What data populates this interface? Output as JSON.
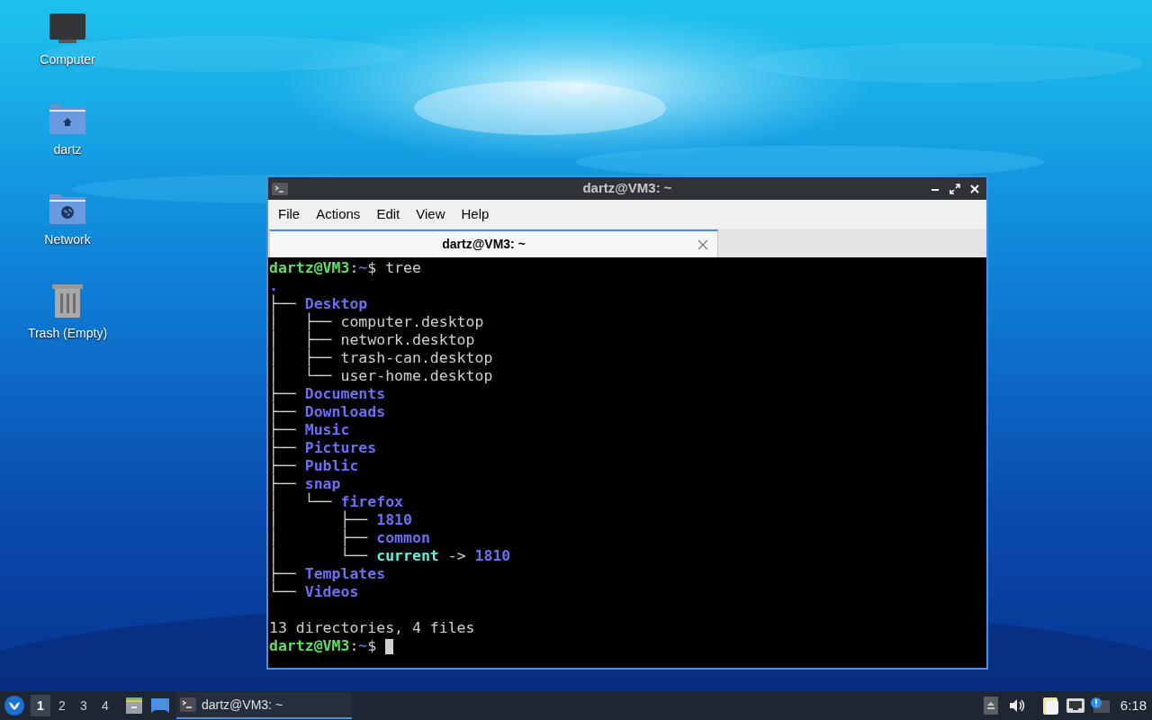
{
  "desktop_icons": [
    {
      "label": "Computer",
      "kind": "computer"
    },
    {
      "label": "dartz",
      "kind": "home"
    },
    {
      "label": "Network",
      "kind": "network"
    },
    {
      "label": "Trash (Empty)",
      "kind": "trash"
    }
  ],
  "window": {
    "title": "dartz@VM3: ~",
    "menu": [
      "File",
      "Actions",
      "Edit",
      "View",
      "Help"
    ],
    "tabs": [
      {
        "label": "dartz@VM3: ~",
        "selected": true
      }
    ],
    "terminal_lines": [
      {
        "segments": [
          {
            "kind": "user",
            "text": "dartz@VM3"
          },
          {
            "kind": "plain",
            "text": ":"
          },
          {
            "kind": "path",
            "text": "~"
          },
          {
            "kind": "plain",
            "text": "$ tree"
          }
        ]
      },
      {
        "segments": [
          {
            "kind": "path",
            "text": "."
          }
        ]
      },
      {
        "segments": [
          {
            "kind": "plain",
            "text": "├── "
          },
          {
            "kind": "dir",
            "text": "Desktop"
          }
        ]
      },
      {
        "segments": [
          {
            "kind": "plain",
            "text": "│   ├── computer.desktop"
          }
        ]
      },
      {
        "segments": [
          {
            "kind": "plain",
            "text": "│   ├── network.desktop"
          }
        ]
      },
      {
        "segments": [
          {
            "kind": "plain",
            "text": "│   ├── trash-can.desktop"
          }
        ]
      },
      {
        "segments": [
          {
            "kind": "plain",
            "text": "│   └── user-home.desktop"
          }
        ]
      },
      {
        "segments": [
          {
            "kind": "plain",
            "text": "├── "
          },
          {
            "kind": "dir",
            "text": "Documents"
          }
        ]
      },
      {
        "segments": [
          {
            "kind": "plain",
            "text": "├── "
          },
          {
            "kind": "dir",
            "text": "Downloads"
          }
        ]
      },
      {
        "segments": [
          {
            "kind": "plain",
            "text": "├── "
          },
          {
            "kind": "dir",
            "text": "Music"
          }
        ]
      },
      {
        "segments": [
          {
            "kind": "plain",
            "text": "├── "
          },
          {
            "kind": "dir",
            "text": "Pictures"
          }
        ]
      },
      {
        "segments": [
          {
            "kind": "plain",
            "text": "├── "
          },
          {
            "kind": "dir",
            "text": "Public"
          }
        ]
      },
      {
        "segments": [
          {
            "kind": "plain",
            "text": "├── "
          },
          {
            "kind": "dir",
            "text": "snap"
          }
        ]
      },
      {
        "segments": [
          {
            "kind": "plain",
            "text": "│   └── "
          },
          {
            "kind": "dir",
            "text": "firefox"
          }
        ]
      },
      {
        "segments": [
          {
            "kind": "plain",
            "text": "│       ├── "
          },
          {
            "kind": "dir",
            "text": "1810"
          }
        ]
      },
      {
        "segments": [
          {
            "kind": "plain",
            "text": "│       ├── "
          },
          {
            "kind": "dir",
            "text": "common"
          }
        ]
      },
      {
        "segments": [
          {
            "kind": "plain",
            "text": "│       └── "
          },
          {
            "kind": "link",
            "text": "current"
          },
          {
            "kind": "plain",
            "text": " -> "
          },
          {
            "kind": "dir",
            "text": "1810"
          }
        ]
      },
      {
        "segments": [
          {
            "kind": "plain",
            "text": "├── "
          },
          {
            "kind": "dir",
            "text": "Templates"
          }
        ]
      },
      {
        "segments": [
          {
            "kind": "plain",
            "text": "└── "
          },
          {
            "kind": "dir",
            "text": "Videos"
          }
        ]
      },
      {
        "kind": "blank"
      },
      {
        "segments": [
          {
            "kind": "plain",
            "text": "13 directories, 4 files"
          }
        ]
      },
      {
        "segments": [
          {
            "kind": "user",
            "text": "dartz@VM3"
          },
          {
            "kind": "plain",
            "text": ":"
          },
          {
            "kind": "path",
            "text": "~"
          },
          {
            "kind": "plain",
            "text": "$ "
          }
        ],
        "cursor": true
      }
    ]
  },
  "taskbar": {
    "workspaces": [
      {
        "label": "1",
        "selected": true
      },
      {
        "label": "2",
        "selected": false
      },
      {
        "label": "3",
        "selected": false
      },
      {
        "label": "4",
        "selected": false
      }
    ],
    "tasks": [
      {
        "label": "dartz@VM3: ~",
        "selected": true
      }
    ],
    "clock": "6:18"
  }
}
